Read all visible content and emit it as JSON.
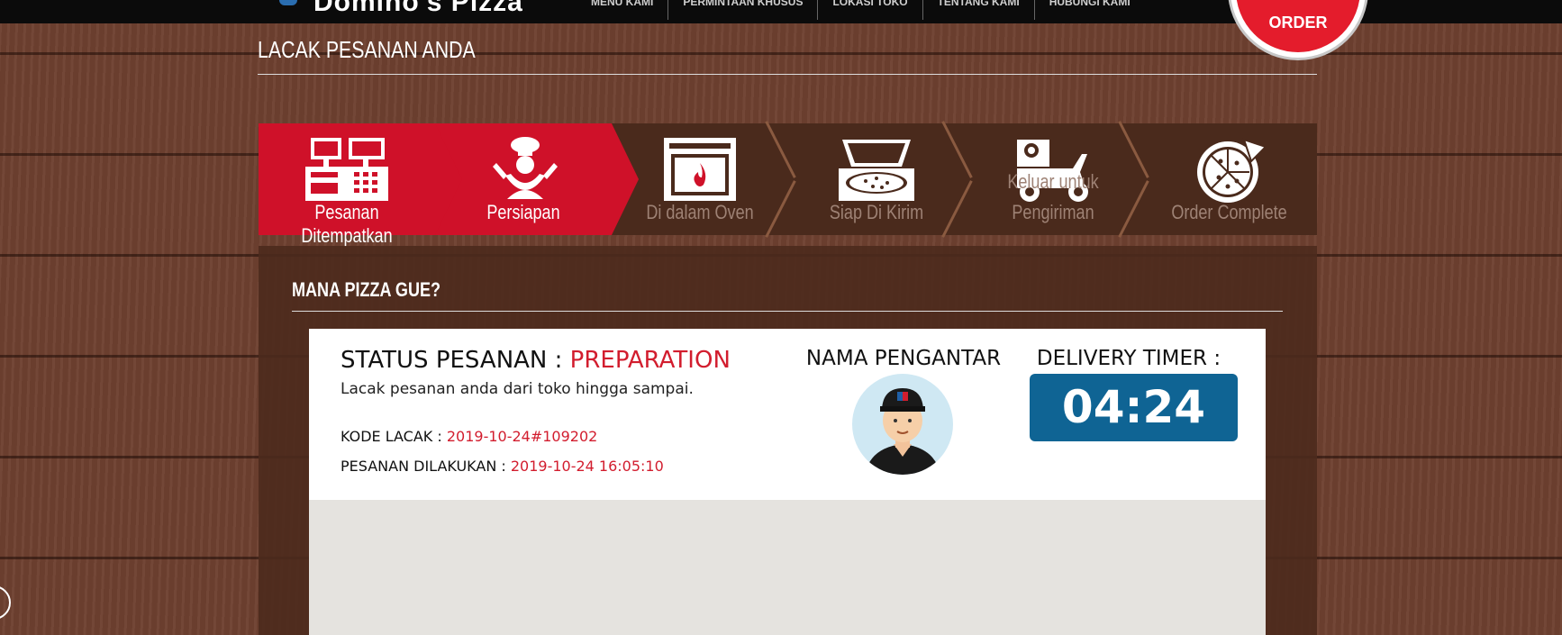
{
  "header": {
    "logo_text": "Domino's Pizza",
    "nav": [
      "MENU KAMI",
      "PERMINTAAN KHUSUS",
      "LOKASI TOKO",
      "TENTANG KAMI",
      "HUBUNGI KAMI"
    ],
    "order_button": "ORDER"
  },
  "page": {
    "title": "LACAK PESANAN ANDA"
  },
  "steps": [
    {
      "label": "Pesanan Ditempatkan",
      "active": true,
      "icon": "cash-register-icon"
    },
    {
      "label": "Persiapan",
      "active": true,
      "icon": "chef-icon"
    },
    {
      "label": "Di dalam Oven",
      "active": false,
      "icon": "oven-icon"
    },
    {
      "label": "Siap Di Kirim",
      "active": false,
      "icon": "pizza-box-icon"
    },
    {
      "label_top": "Keluar untuk",
      "label": "Pengiriman",
      "active": false,
      "icon": "delivery-scooter-icon"
    },
    {
      "label": "Order Complete",
      "active": false,
      "icon": "pizza-icon"
    }
  ],
  "panel": {
    "title": "MANA PIZZA GUE?"
  },
  "tracker": {
    "status_label": "STATUS PESANAN : ",
    "status_value": "PREPARATION",
    "description": "Lacak pesanan anda dari toko hingga sampai.",
    "code_label": "KODE LACAK : ",
    "code_value": "2019-10-24#109202",
    "placed_label": "PESANAN DILAKUKAN : ",
    "placed_value": "2019-10-24 16:05:10",
    "driver_label": "NAMA PENGANTAR :",
    "timer_label": "DELIVERY TIMER :",
    "timer_value": "04:24"
  },
  "colors": {
    "accent_red": "#cf1129",
    "timer_blue": "#0f6494",
    "status_red": "#d21d2e"
  }
}
